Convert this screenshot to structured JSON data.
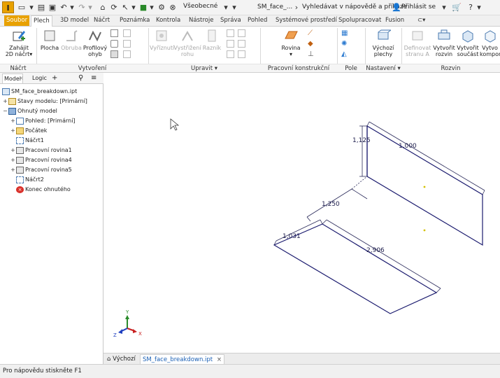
{
  "titlebar": {
    "logo": "I",
    "material": "Všeobecné",
    "doc_title": "SM_face_...",
    "help_search": "Vyhledávat v nápovědě a příkaze",
    "signin": "Přihlásit se"
  },
  "tabs": [
    {
      "label": "Soubor"
    },
    {
      "label": "Plech"
    },
    {
      "label": "3D model"
    },
    {
      "label": "Náčrt"
    },
    {
      "label": "Poznámka"
    },
    {
      "label": "Kontrola"
    },
    {
      "label": "Nástroje"
    },
    {
      "label": "Správa"
    },
    {
      "label": "Pohled"
    },
    {
      "label": "Systémové prostředí"
    },
    {
      "label": "Spolupracovat"
    },
    {
      "label": "Fusion"
    }
  ],
  "ribbon": {
    "nacrt": {
      "title": "Náčrt",
      "btn_line1": "Zahájit",
      "btn_line2": "2D náčrt"
    },
    "vytvoreni": {
      "title": "Vytvoření",
      "plocha": "Plocha",
      "obruba": "Obruba",
      "profil1": "Profilový",
      "profil2": "ohyb"
    },
    "upravit": {
      "title": "Upravit",
      "vyriznuti": "Vyříznutí",
      "vystrizeni1": "Vystřižení",
      "vystrizeni2": "rohu",
      "raznik": "Razník"
    },
    "prac": {
      "title": "Pracovní konstrukční prvky",
      "rovina": "Rovina"
    },
    "pole": {
      "title": "Pole"
    },
    "nastaveni": {
      "title": "Nastavení",
      "vychozi1": "Výchozí",
      "vychozi2": "plechy"
    },
    "rozvin": {
      "title": "Rozvin",
      "definovat1": "Definovat",
      "definovat2": "stranu A",
      "vytvorit_rozvin1": "Vytvořit",
      "vytvorit_rozvin2": "rozvin",
      "vytvorit_soucast1": "Vytvořit",
      "vytvorit_soucast2": "součást",
      "vytvorit_komp1": "Vytvo",
      "vytvorit_komp2": "kompon"
    }
  },
  "browser": {
    "tab_model": "Model",
    "tab_logic": "Logic",
    "tab_add": "+",
    "tree": [
      {
        "label": "SM_face_breakdown.ipt",
        "exp": ""
      },
      {
        "label": "Stavy modelu: [Primární]",
        "exp": "+"
      },
      {
        "label": "Ohnutý model",
        "exp": "−"
      },
      {
        "label": "Pohled: [Primární]",
        "exp": "+"
      },
      {
        "label": "Počátek",
        "exp": "+"
      },
      {
        "label": "Náčrt1",
        "exp": ""
      },
      {
        "label": "Pracovní rovina1",
        "exp": "+"
      },
      {
        "label": "Pracovní rovina4",
        "exp": "+"
      },
      {
        "label": "Pracovní rovina5",
        "exp": "+"
      },
      {
        "label": "Náčrt2",
        "exp": ""
      },
      {
        "label": "Konec ohnutého",
        "exp": ""
      }
    ]
  },
  "canvas": {
    "dims": {
      "d1": "1,125",
      "d2": "1,000",
      "d3": "1,250",
      "d4": "1,031",
      "d5": "2,906"
    },
    "axes": {
      "x": "X",
      "y": "Y",
      "z": "Z"
    }
  },
  "doctabs": {
    "home": "Výchozí",
    "active": "SM_face_breakdown.ipt",
    "close": "×"
  },
  "status": {
    "text": "Pro nápovědu stiskněte F1"
  },
  "colors": {
    "accent": "#e8a100",
    "model_line": "#1a1a6e",
    "active_tab": "#1a5fb4"
  }
}
